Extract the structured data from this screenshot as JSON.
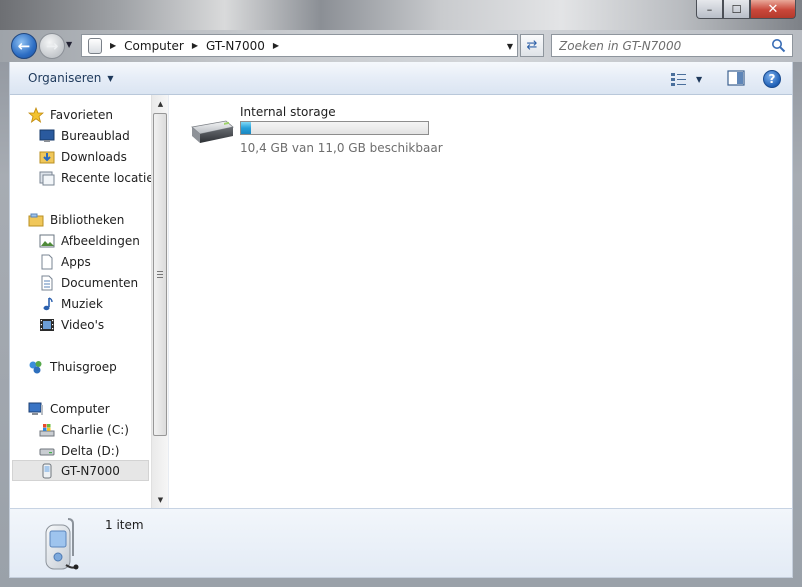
{
  "window": {
    "minimize_glyph": "–",
    "maximize_glyph": "☐",
    "close_glyph": "✕"
  },
  "address": {
    "breadcrumbs": [
      "Computer",
      "GT-N7000"
    ],
    "search_placeholder": "Zoeken in GT-N7000"
  },
  "toolbar": {
    "organize_label": "Organiseren"
  },
  "navigation": {
    "favorites": {
      "label": "Favorieten",
      "items": [
        "Bureaublad",
        "Downloads",
        "Recente locaties"
      ]
    },
    "libraries": {
      "label": "Bibliotheken",
      "items": [
        "Afbeeldingen",
        "Apps",
        "Documenten",
        "Muziek",
        "Video's"
      ]
    },
    "homegroup": {
      "label": "Thuisgroep"
    },
    "computer": {
      "label": "Computer",
      "items": [
        "Charlie (C:)",
        "Delta (D:)",
        "GT-N7000"
      ]
    }
  },
  "drive": {
    "name": "Internal storage",
    "free_text": "10,4 GB van 11,0 GB beschikbaar",
    "used_fraction": 0.055
  },
  "details": {
    "item_count": "1 item"
  },
  "colors": {
    "accent_blue": "#2d6ec4",
    "bar_fill": "#26a0da"
  }
}
